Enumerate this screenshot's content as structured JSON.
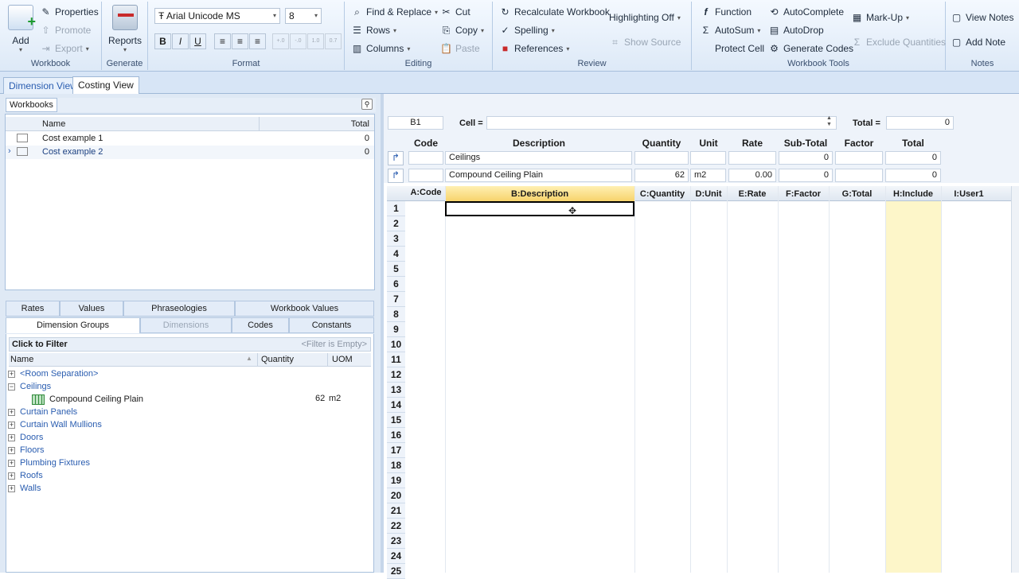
{
  "ribbon": {
    "workbook": {
      "label": "Workbook",
      "add": "Add",
      "properties": "Properties",
      "promote": "Promote",
      "export": "Export"
    },
    "generate": {
      "label": "Generate",
      "reports": "Reports"
    },
    "format": {
      "label": "Format",
      "font": "Arial Unicode MS",
      "size": "8",
      "bold": "B",
      "italic": "I",
      "underline": "U",
      "dec_inc": "+.0",
      "dec_dec": "-.0",
      "dec_a": "1.0",
      "dec_b": "0.7"
    },
    "editing": {
      "label": "Editing",
      "find": "Find & Replace",
      "rows": "Rows",
      "columns": "Columns",
      "cut": "Cut",
      "copy": "Copy",
      "paste": "Paste"
    },
    "review": {
      "label": "Review",
      "recalc": "Recalculate Workbook",
      "highlight": "Highlighting Off",
      "spelling": "Spelling",
      "references": "References",
      "show_source": "Show Source"
    },
    "tools": {
      "label": "Workbook Tools",
      "function": "Function",
      "autosum": "AutoSum",
      "protect": "Protect Cell",
      "autocomplete": "AutoComplete",
      "autodrop": "AutoDrop",
      "gencodes": "Generate Codes",
      "markup": "Mark-Up",
      "exclude": "Exclude Quantities"
    },
    "notes": {
      "label": "Notes",
      "view": "View Notes",
      "add": "Add Note"
    }
  },
  "views": {
    "dimension": "Dimension View",
    "costing": "Costing View"
  },
  "workbooks": {
    "title": "Workbooks",
    "col_name": "Name",
    "col_total": "Total",
    "rows": [
      {
        "name": "Cost example 1",
        "total": "0"
      },
      {
        "name": "Cost example 2",
        "total": "0"
      }
    ]
  },
  "bottom_tabs": {
    "rates": "Rates",
    "values": "Values",
    "phraseologies": "Phraseologies",
    "wb_values": "Workbook Values",
    "dim_groups": "Dimension Groups",
    "dimensions": "Dimensions",
    "codes": "Codes",
    "constants": "Constants"
  },
  "filter": {
    "label": "Click to Filter",
    "empty": "<Filter is Empty>"
  },
  "groups": {
    "col_name": "Name",
    "col_qty": "Quantity",
    "col_uom": "UOM",
    "items": [
      "<Room Separation>",
      "Ceilings",
      "Curtain Panels",
      "Curtain Wall Mullions",
      "Doors",
      "Floors",
      "Plumbing Fixtures",
      "Roofs",
      "Walls"
    ],
    "child": {
      "name": "Compound Ceiling Plain",
      "qty": "62",
      "uom": "m2"
    }
  },
  "formula": {
    "ref": "B1",
    "cell_label": "Cell =",
    "total_label": "Total =",
    "total": "0"
  },
  "cost": {
    "headers": [
      "Code",
      "Description",
      "Quantity",
      "Unit",
      "Rate",
      "Sub-Total",
      "Factor",
      "Total"
    ],
    "row1": {
      "desc": "Ceilings",
      "subtotal": "0",
      "total": "0"
    },
    "row2": {
      "desc": "Compound Ceiling Plain",
      "qty": "62",
      "unit": "m2",
      "rate": "0.00",
      "subtotal": "0",
      "total": "0"
    }
  },
  "grid": {
    "cols": [
      "A:Code",
      "B:Description",
      "C:Quantity",
      "D:Unit",
      "E:Rate",
      "F:Factor",
      "G:Total",
      "H:Include",
      "I:User1"
    ],
    "rows": [
      "1",
      "2",
      "3",
      "4",
      "5",
      "6",
      "7",
      "8",
      "9",
      "10",
      "11",
      "12",
      "13",
      "14",
      "15",
      "16",
      "17",
      "18",
      "19",
      "20",
      "21",
      "22",
      "23",
      "24",
      "25"
    ]
  },
  "colors": {
    "ribbon": "#dde9f7",
    "accent": "#2a5db0",
    "include_col": "#fdf6c9"
  }
}
